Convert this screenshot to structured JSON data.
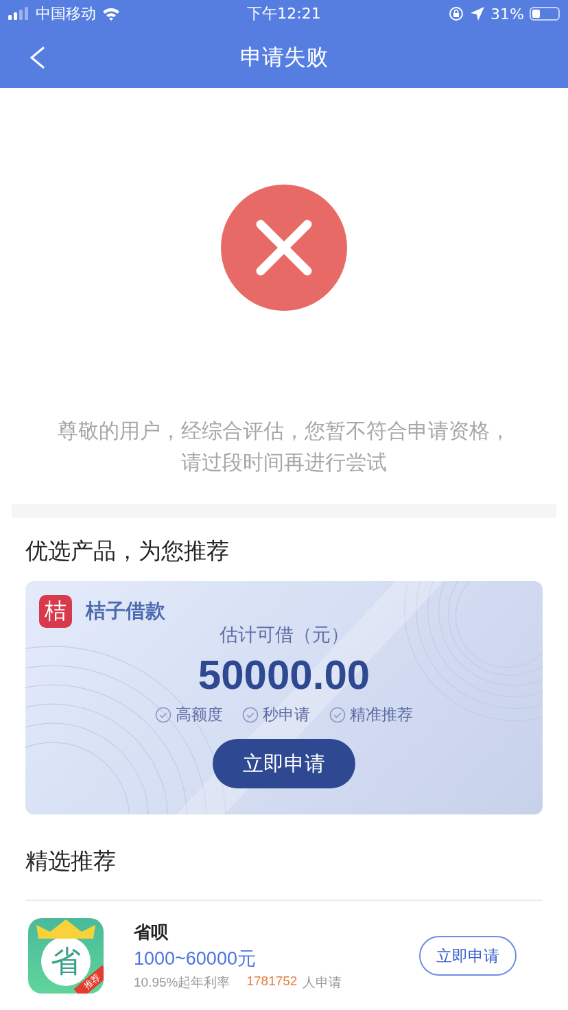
{
  "status_bar": {
    "carrier": "中国移动",
    "time": "下午12:21",
    "battery": "31%"
  },
  "nav": {
    "title": "申请失败"
  },
  "result": {
    "failed": true,
    "message": [
      "尊敬的用户，经综合评估，您暂不符合申请资格，",
      "请过段时间再进行尝试"
    ]
  },
  "featured": {
    "heading": "优选产品，为您推荐",
    "card": {
      "logo_text": "桔",
      "name": "桔子借款",
      "amount_label": "估计可借（元）",
      "amount": "50000.00",
      "features": [
        "高额度",
        "秒申请",
        "精准推荐"
      ],
      "button": "立即申请"
    }
  },
  "recommend": {
    "heading": "精选推荐",
    "items": [
      {
        "logo_text": "省",
        "ribbon": "推荐",
        "name": "省呗",
        "range": "1000~60000元",
        "rate": "10.95%起年利率",
        "applicants": "1781752",
        "applicants_suffix": "人申请",
        "button": "立即申请"
      }
    ]
  }
}
